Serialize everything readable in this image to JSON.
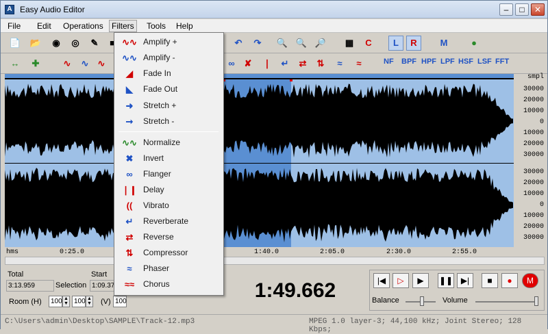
{
  "window": {
    "title": "Easy Audio Editor"
  },
  "menubar": [
    "File",
    "Edit",
    "Operations",
    "Filters",
    "Tools",
    "Help"
  ],
  "toolbar2_labels": [
    "NF",
    "BPF",
    "HPF",
    "LPF",
    "HSF",
    "LSF",
    "FFT"
  ],
  "channel_toggle": {
    "left": "L",
    "right": "R"
  },
  "filters_menu": {
    "group1": [
      {
        "label": "Amplify +",
        "icon": "amplify-plus-icon"
      },
      {
        "label": "Amplify -",
        "icon": "amplify-minus-icon"
      },
      {
        "label": "Fade In",
        "icon": "fade-in-icon"
      },
      {
        "label": "Fade Out",
        "icon": "fade-out-icon"
      },
      {
        "label": "Stretch +",
        "icon": "stretch-plus-icon"
      },
      {
        "label": "Stretch -",
        "icon": "stretch-minus-icon"
      }
    ],
    "group2": [
      {
        "label": "Normalize",
        "icon": "normalize-icon"
      },
      {
        "label": "Invert",
        "icon": "invert-icon"
      },
      {
        "label": "Flanger",
        "icon": "flanger-icon"
      },
      {
        "label": "Delay",
        "icon": "delay-icon"
      },
      {
        "label": "Vibrato",
        "icon": "vibrato-icon"
      },
      {
        "label": "Reverberate",
        "icon": "reverberate-icon"
      },
      {
        "label": "Reverse",
        "icon": "reverse-icon"
      },
      {
        "label": "Compressor",
        "icon": "compressor-icon"
      },
      {
        "label": "Phaser",
        "icon": "phaser-icon"
      },
      {
        "label": "Chorus",
        "icon": "chorus-icon"
      }
    ]
  },
  "scale": {
    "unit": "smpl",
    "top": [
      "30000",
      "20000",
      "10000",
      "0",
      "10000",
      "20000",
      "30000"
    ],
    "bottom": [
      "30000",
      "20000",
      "10000",
      "0",
      "10000",
      "20000",
      "30000"
    ]
  },
  "timeline": {
    "unit": "hms",
    "ticks": [
      "0:25.0",
      "1:40.0",
      "2:05.0",
      "2:30.0",
      "2:55.0"
    ]
  },
  "info": {
    "total_label": "Total",
    "total_value": "3:13.959",
    "selection_label": "Selection",
    "start_label": "Start",
    "start_value": "1:09.37",
    "room_label": "Room (H)",
    "room_h": "100",
    "room_v_label": "(V)",
    "room_v": "100",
    "room_3": "100"
  },
  "timecode": "1:49.662",
  "transport": {
    "balance_label": "Balance",
    "volume_label": "Volume"
  },
  "status": {
    "path": "C:\\Users\\admin\\Desktop\\SAMPLE\\Track-12.mp3",
    "format": "MPEG 1.0 layer-3; 44,100 kHz; Joint Stereo; 128 Kbps;"
  },
  "colors": {
    "waveform": "#000000",
    "wave_bg": "#9ec0e6",
    "selection": "#5a8fd2",
    "accent_blue": "#1f52c4",
    "accent_red": "#d00000"
  }
}
